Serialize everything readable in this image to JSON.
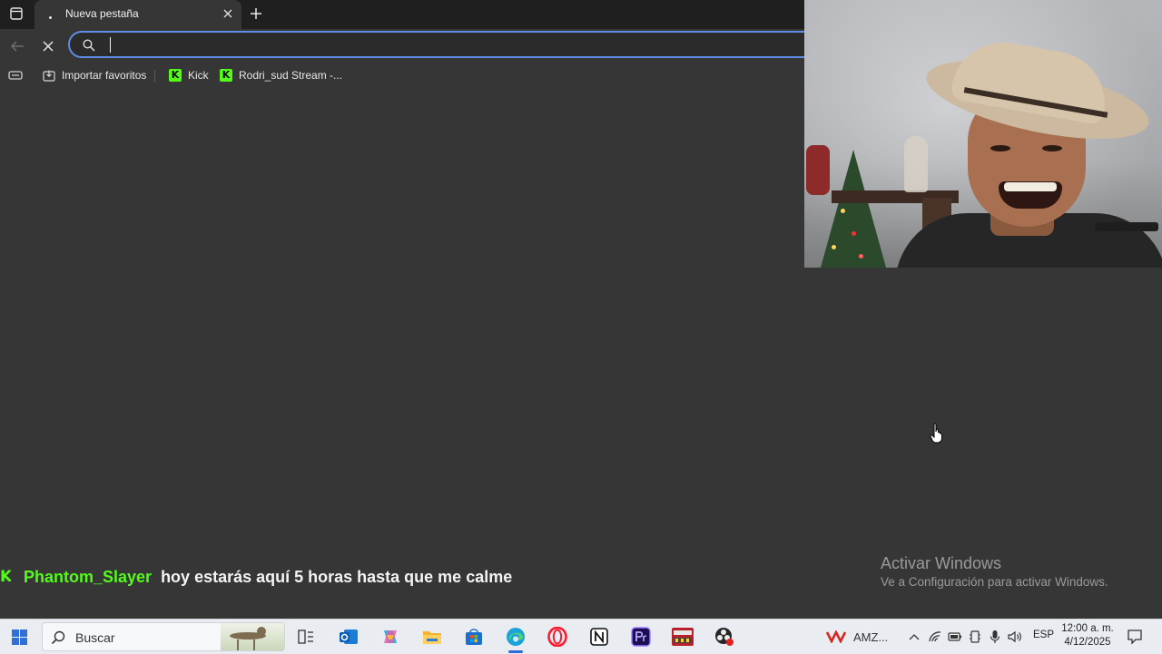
{
  "browser": {
    "tab": {
      "title": "Nueva pestaña"
    },
    "omnibox": {
      "value": "",
      "placeholder": ""
    },
    "bookmarks": [
      {
        "label": "Importar favoritos",
        "icon": "import-icon"
      },
      {
        "label": "Kick",
        "icon": "kick-icon"
      },
      {
        "label": "Rodri_sud Stream -...",
        "icon": "kick-icon"
      }
    ],
    "accent": "#5e8ce6"
  },
  "chat": {
    "badge": "K",
    "username": "Phantom_Slayer",
    "message": "hoy estarás aquí 5 horas hasta que me calme",
    "username_color": "#53fc18"
  },
  "watermark": {
    "title": "Activar Windows",
    "subtitle": "Ve a Configuración para activar Windows."
  },
  "taskbar": {
    "search_label": "Buscar",
    "apps": [
      "task-view-icon",
      "outlook-icon",
      "copilot-icon",
      "file-explorer-icon",
      "microsoft-store-icon",
      "edge-icon",
      "opera-icon",
      "notion-icon",
      "premiere-icon",
      "voicemeeter-icon",
      "obs-icon"
    ],
    "tray_app_label": "AMZ...",
    "language": "ESP",
    "time": "12:00 a. m.",
    "date": "4/12/2025"
  }
}
